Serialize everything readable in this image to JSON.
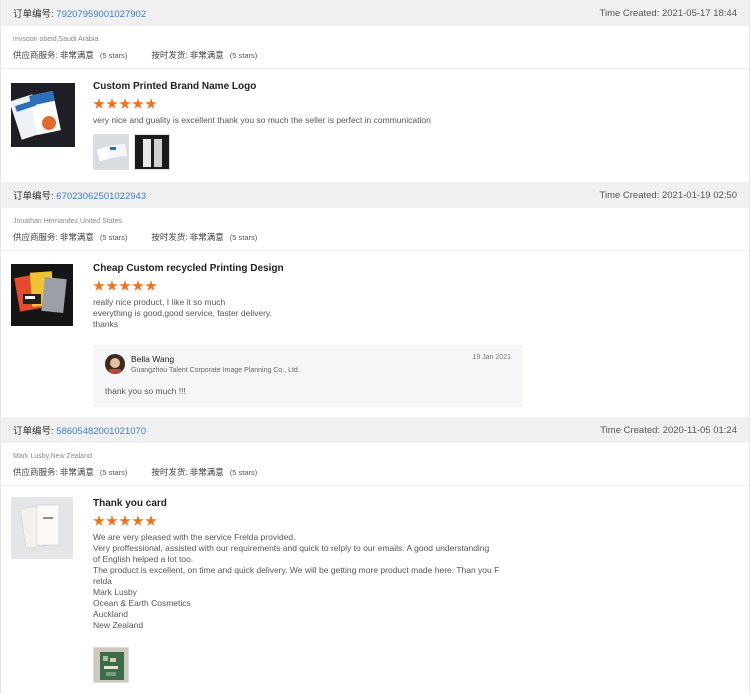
{
  "labels": {
    "order_no": "订单编号:",
    "supplier_service": "供应商服务:",
    "on_time_delivery": "按时发货:"
  },
  "orders": [
    {
      "order_no": "79207959001027902",
      "time_created": "Time Created: 2021-05-17 18:44",
      "buyer": "mvsoon obeid,Saudi Arabia",
      "supplier_service_value": "非常满意",
      "supplier_service_stars": "(5 stars)",
      "on_time_value": "非常满意",
      "on_time_stars": "(5 stars)",
      "product_title": "Custom Printed Brand Name Logo",
      "rating": 5,
      "review_text": "very nice and guality is excellent thank you so much the seller is perfect in communication"
    },
    {
      "order_no": "67023062501022943",
      "time_created": "Time Created: 2021-01-19 02:50",
      "buyer": "Jonathan Hernandez,United States",
      "supplier_service_value": "非常满意",
      "supplier_service_stars": "(5 stars)",
      "on_time_value": "非常满意",
      "on_time_stars": "(5 stars)",
      "product_title": "Cheap Custom recycled Printing Design",
      "rating": 5,
      "review_text": "really nice product, I like it so much\neverything is good,good service, faster delivery.\nthanks",
      "reply": {
        "name": "Bella Wang",
        "company": "Guangzhou Talent Corporate Image Planning Co., Ltd.",
        "date": "19 Jan 2021",
        "text": "thank you so much !!!"
      }
    },
    {
      "order_no": "58605482001021070",
      "time_created": "Time Created: 2020-11-05 01:24",
      "buyer": "Mark Lusby,New Zealand",
      "supplier_service_value": "非常满意",
      "supplier_service_stars": "(5 stars)",
      "on_time_value": "非常满意",
      "on_time_stars": "(5 stars)",
      "product_title": "Thank you card",
      "rating": 5,
      "review_text": "We are very pleased with the service Frelda provided.\nVery proffessional, assisted with our requirements and quick to relply to our emails. A good understanding\nof English helped a lot too.\nThe product is excellent, on time and quick delivery. We will be getting more product made here. Than you F\nrelda\nMark Lusby\nOcean & Earth Cosmetics\nAuckland\nNew Zealand"
    }
  ],
  "colors": {
    "star": "#f0701c",
    "order_link": "#3b7fc4",
    "header_bg": "#f0f0f0"
  }
}
